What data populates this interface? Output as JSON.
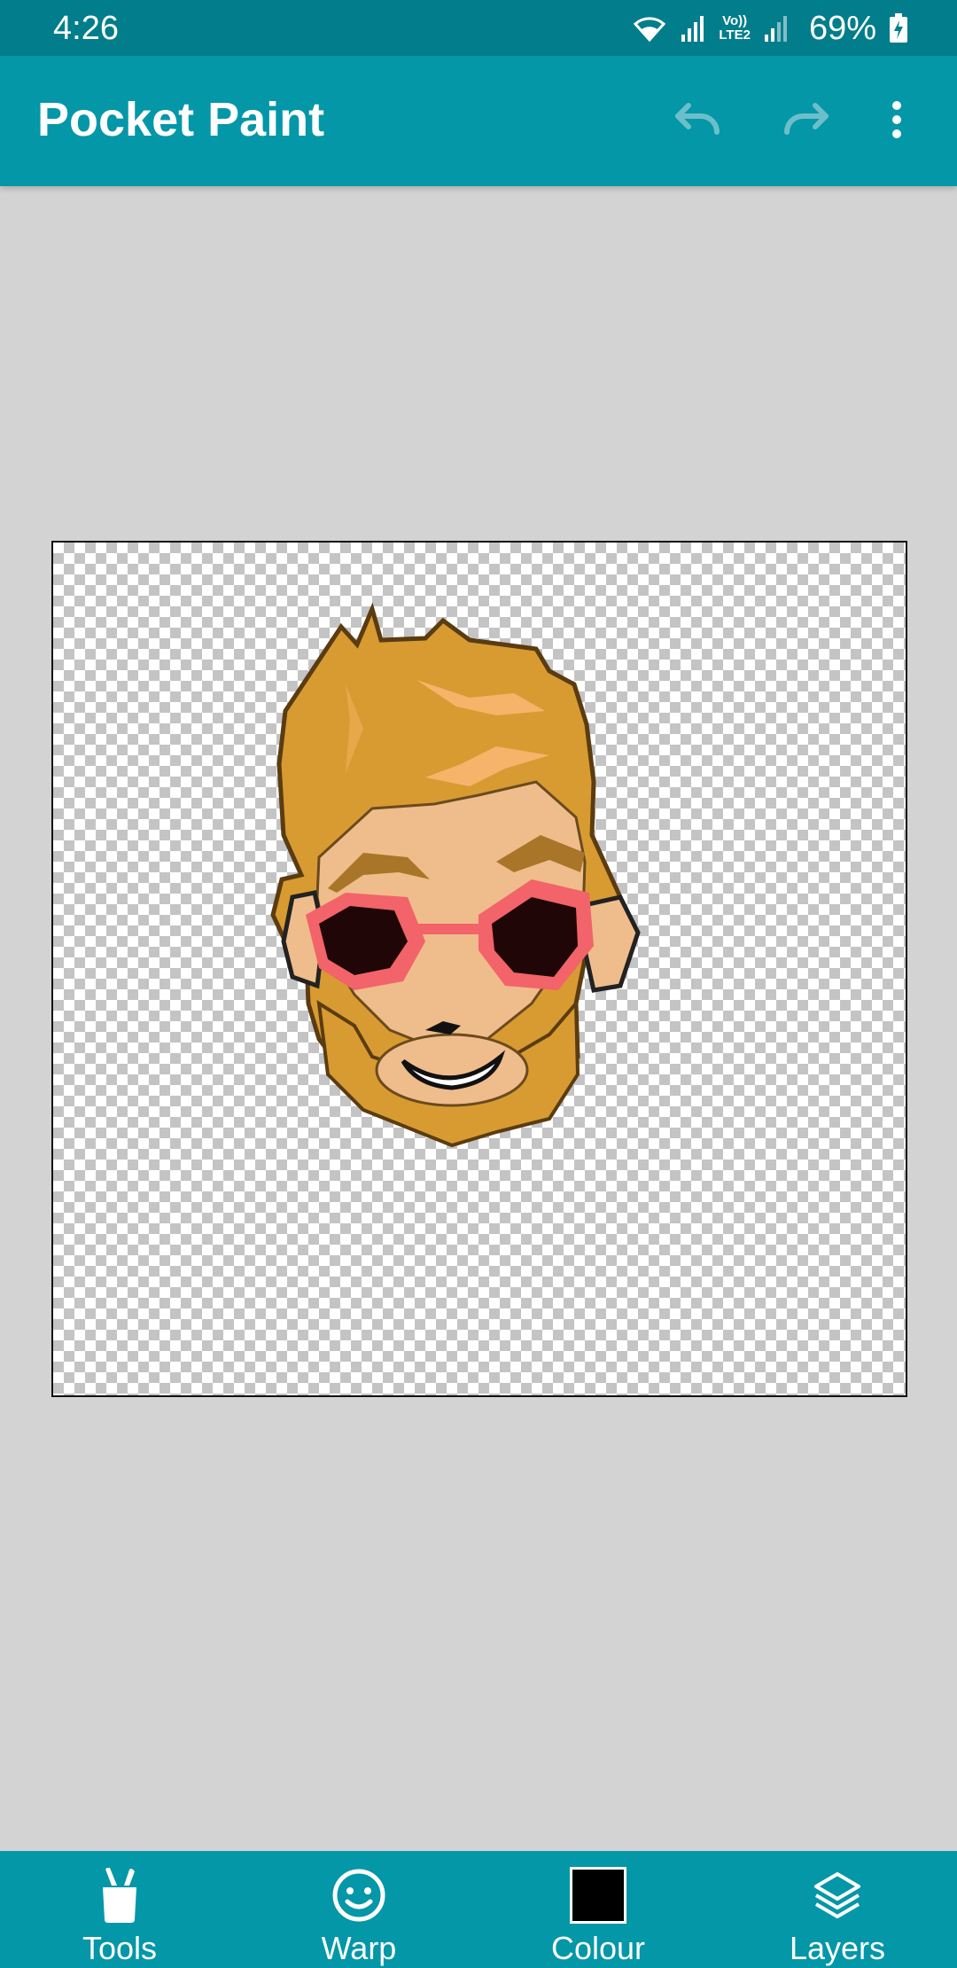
{
  "status_bar": {
    "time": "4:26",
    "network_label_top": "Vo))",
    "network_label_bottom": "LTE2",
    "battery_percent": "69%",
    "icons": [
      "wifi-icon",
      "signal-icon",
      "signal-icon",
      "battery-charging-icon"
    ]
  },
  "app_bar": {
    "title": "Pocket Paint",
    "actions": [
      {
        "name": "undo",
        "icon": "undo-icon",
        "enabled": false
      },
      {
        "name": "redo",
        "icon": "redo-icon",
        "enabled": false
      },
      {
        "name": "more",
        "icon": "more-vert-icon",
        "enabled": true
      }
    ]
  },
  "canvas": {
    "background": "transparent-checkerboard",
    "content": "bearded-face-sticker"
  },
  "bottom_bar": {
    "items": [
      {
        "label": "Tools",
        "icon": "tools-icon"
      },
      {
        "label": "Warp",
        "icon": "warp-icon"
      },
      {
        "label": "Colour",
        "icon": "colour-swatch",
        "current_color": "#000000"
      },
      {
        "label": "Layers",
        "icon": "layers-icon"
      }
    ]
  },
  "colors": {
    "status_bar": "#017d8c",
    "primary": "#0397a8",
    "workspace": "#d3d3d3"
  }
}
